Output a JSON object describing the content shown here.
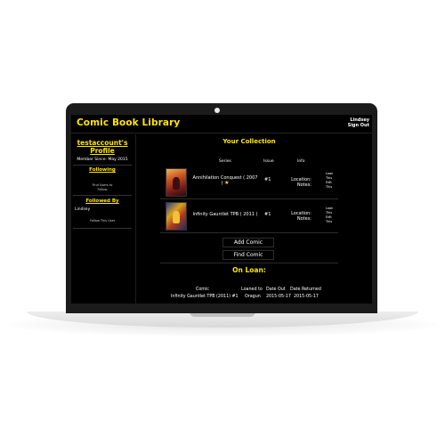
{
  "app": {
    "title": "Comic Book Library",
    "user_name": "Lindsey",
    "sign_out_label": "Sign Out"
  },
  "sidebar": {
    "profile_title_1": "testaccount's",
    "profile_title_2": "Profile",
    "member_since": "Member Since: May 2015",
    "following_title": "Following",
    "find_users_line1": "Find Users to",
    "find_users_line2": "Follow",
    "followed_by_title": "Followed By",
    "follower_name": "Lindsey",
    "follow_this_user": "Follow This User"
  },
  "collection": {
    "title": "Your Collection",
    "columns": {
      "series": "Series",
      "issue": "Issue",
      "info": "Info"
    },
    "rows": [
      {
        "series": "Annihilation Conquest ( 2007",
        "series_line2": ")",
        "issue": "#1",
        "location_label": "Location:",
        "notes_label": "Notes:",
        "actions": [
          "Loan",
          "This",
          "Edit",
          "This"
        ]
      },
      {
        "series": "Infinity Gauntlet TPB ( 2011 )",
        "issue": "#1",
        "location_label": "Location:",
        "notes_label": "Notes:",
        "actions": [
          "Loan",
          "This",
          "Edit",
          "This"
        ]
      }
    ],
    "add_button": "Add Comic",
    "find_button": "Find Comic"
  },
  "on_loan": {
    "title": "On Loan:",
    "headers": {
      "comic": "Comic",
      "loaned_to": "Loaned to",
      "date_out": "Date Out",
      "date_returned": "Date Returned"
    },
    "row": {
      "comic": "Infinity Gauntlet TPB (2011) #1",
      "loaned_to": "Oragun",
      "date_out": "2015-05-17",
      "date_returned": "2015-05-17"
    }
  },
  "colors": {
    "accent": "#ffe600",
    "background": "#000000",
    "bezel": "#1b1b1b"
  }
}
